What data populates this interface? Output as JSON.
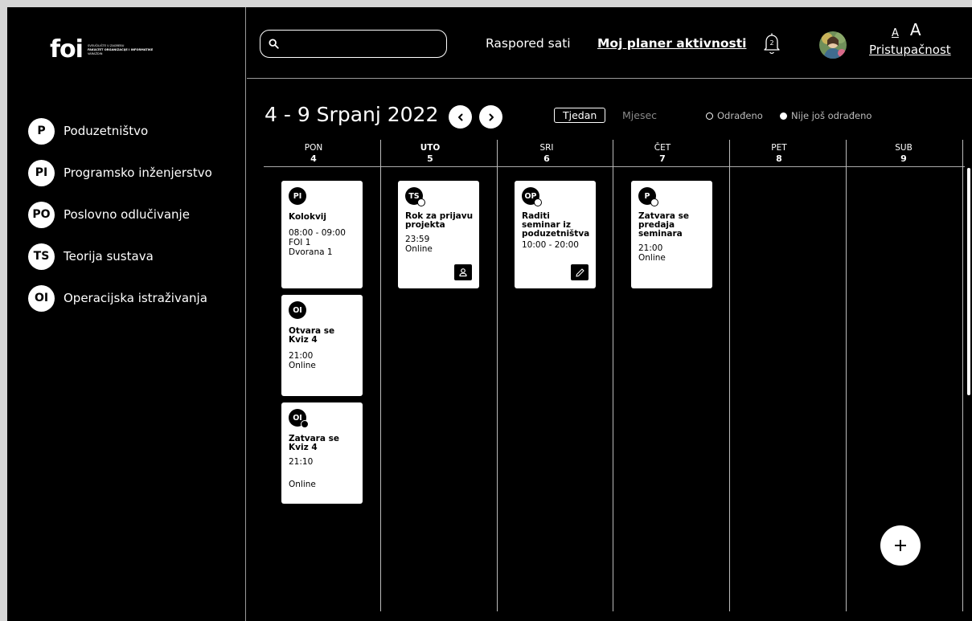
{
  "logo": {
    "word": "foi",
    "line1": "SVEUČILIŠTE U ZAGREBU",
    "line2": "FAKULTET ORGANIZACIJE I INFORMATIKE",
    "line3": "VARAŽDIN"
  },
  "sidebar": {
    "courses": [
      {
        "abbr": "P",
        "label": "Poduzetništvo"
      },
      {
        "abbr": "PI",
        "label": "Programsko inženjerstvo"
      },
      {
        "abbr": "PO",
        "label": "Poslovno odlučivanje"
      },
      {
        "abbr": "TS",
        "label": "Teorija sustava"
      },
      {
        "abbr": "OI",
        "label": "Operacijska istraživanja"
      }
    ]
  },
  "header": {
    "search_placeholder": "",
    "nav_schedule": "Raspored sati",
    "nav_planner": "Moj planer aktivnosti",
    "notification_count": "2",
    "font_small": "A",
    "font_large": "A",
    "accessibility": "Pristupačnost"
  },
  "calendar": {
    "title": "4 - 9 Srpanj 2022",
    "view_week": "Tjedan",
    "view_month": "Mjesec",
    "legend_done": "Odrađeno",
    "legend_not_done": "Nije još odrađeno",
    "days": [
      {
        "name": "PON",
        "num": "4"
      },
      {
        "name": "UTO",
        "num": "5"
      },
      {
        "name": "SRI",
        "num": "6"
      },
      {
        "name": "ČET",
        "num": "7"
      },
      {
        "name": "PET",
        "num": "8"
      },
      {
        "name": "SUB",
        "num": "9"
      }
    ],
    "events": [
      {
        "badge": "PI",
        "title": "Kolokvij",
        "time": "08:00 - 09:00",
        "loc1": "FOI 1",
        "loc2": "Dvorana 1"
      },
      {
        "badge": "OI",
        "title": "Otvara se\nKviz 4",
        "time": "21:00",
        "loc1": "Online"
      },
      {
        "badge": "OI",
        "title": "Zatvara se\nKviz 4",
        "time": "21:10",
        "loc1": "Online"
      },
      {
        "badge": "TS",
        "title": "Rok za prijavu\nprojekta",
        "time": "23:59",
        "loc1": "Online"
      },
      {
        "badge": "OP",
        "title": "Raditi\nseminar iz\npoduzetništva",
        "time": "10:00 - 20:00"
      },
      {
        "badge": "P",
        "title": "Zatvara se\npredaja\nseminara",
        "time": "21:00",
        "loc1": "Online"
      }
    ]
  },
  "colors": {
    "background": "#000000",
    "card": "#ffffff",
    "divider": "#aaaaaa"
  }
}
